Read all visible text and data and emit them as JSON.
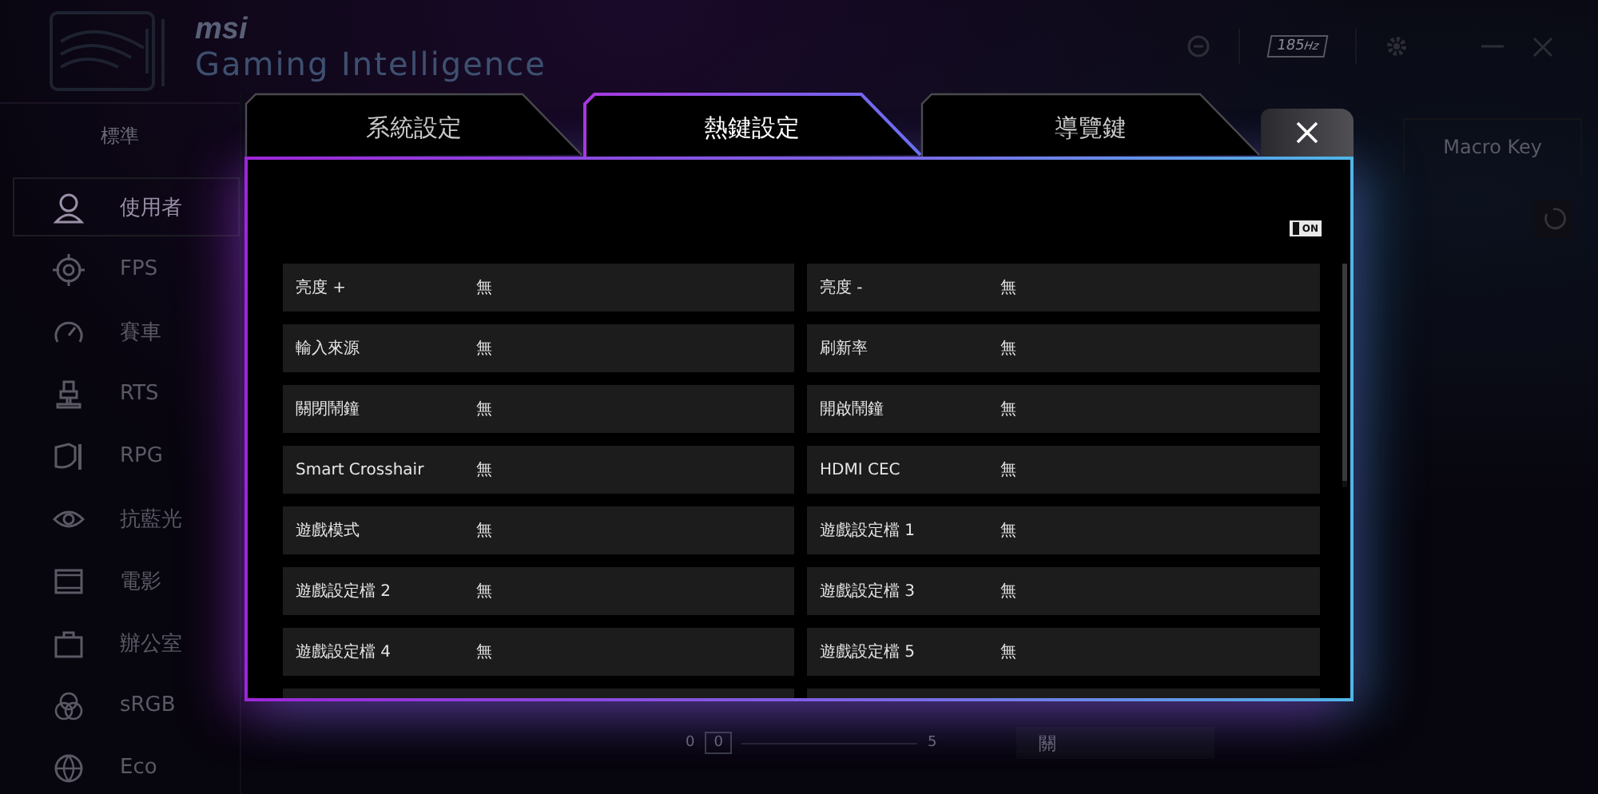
{
  "app": {
    "logo": "msi",
    "title": "Gaming Intelligence",
    "refresh_rate": "185",
    "refresh_unit": "Hz",
    "mode_tab": "標準",
    "right_tab": "Macro Key",
    "sidebar": [
      {
        "label": "使用者",
        "selected": true
      },
      {
        "label": "FPS",
        "selected": false
      },
      {
        "label": "賽車",
        "selected": false
      },
      {
        "label": "RTS",
        "selected": false
      },
      {
        "label": "RPG",
        "selected": false
      },
      {
        "label": "抗藍光",
        "selected": false
      },
      {
        "label": "電影",
        "selected": false
      },
      {
        "label": "辦公室",
        "selected": false
      },
      {
        "label": "sRGB",
        "selected": false
      },
      {
        "label": "Eco",
        "selected": false
      }
    ],
    "slider": {
      "min": "0",
      "value": "0",
      "max": "5"
    },
    "dropdown": {
      "value": "關"
    }
  },
  "dialog": {
    "tabs": [
      {
        "label": "系統設定",
        "selected": false
      },
      {
        "label": "熱鍵設定",
        "selected": true
      },
      {
        "label": "導覽鍵",
        "selected": false
      }
    ],
    "toggle": {
      "label": "ON",
      "on": true
    },
    "hotkeys": [
      {
        "name": "亮度 +",
        "value": "無"
      },
      {
        "name": "亮度 -",
        "value": "無"
      },
      {
        "name": "輸入來源",
        "value": "無"
      },
      {
        "name": "刷新率",
        "value": "無"
      },
      {
        "name": "關閉鬧鐘",
        "value": "無"
      },
      {
        "name": "開啟鬧鐘",
        "value": "無"
      },
      {
        "name": "Smart Crosshair",
        "value": "無"
      },
      {
        "name": "HDMI CEC",
        "value": "無"
      },
      {
        "name": "遊戲模式",
        "value": "無"
      },
      {
        "name": "遊戲設定檔 1",
        "value": "無"
      },
      {
        "name": "遊戲設定檔 2",
        "value": "無"
      },
      {
        "name": "遊戲設定檔 3",
        "value": "無"
      },
      {
        "name": "遊戲設定檔 4",
        "value": "無"
      },
      {
        "name": "遊戲設定檔 5",
        "value": "無"
      }
    ]
  }
}
